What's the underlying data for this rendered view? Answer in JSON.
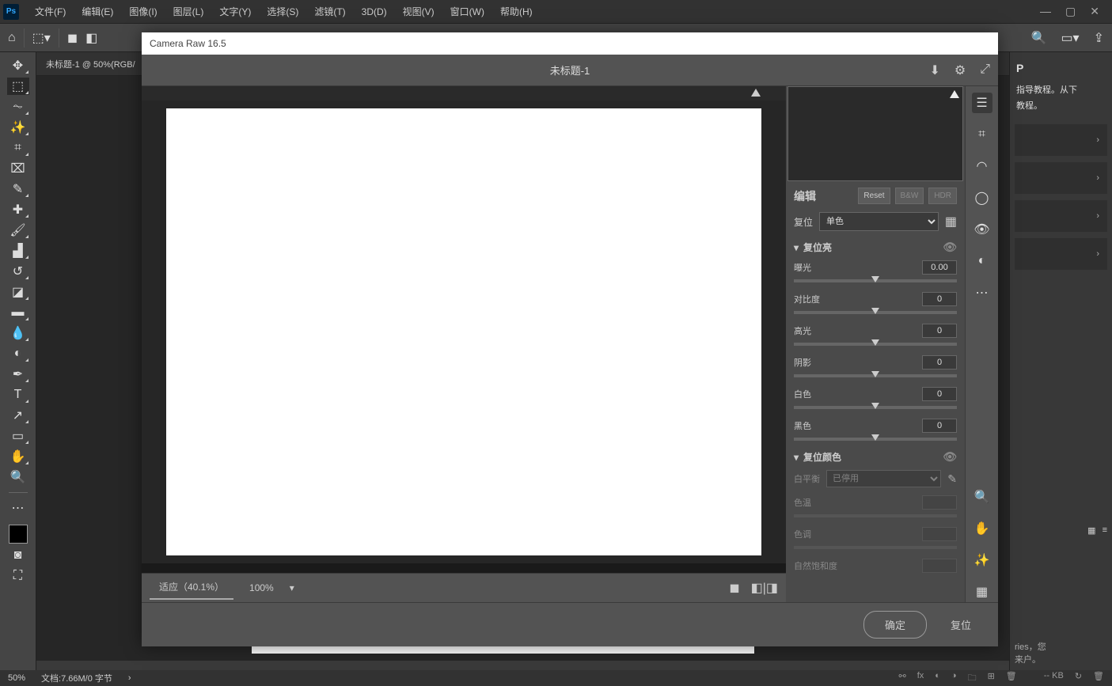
{
  "app": {
    "logo": "Ps"
  },
  "menu": {
    "file": "文件(F)",
    "edit": "编辑(E)",
    "image": "图像(I)",
    "layer": "图层(L)",
    "type": "文字(Y)",
    "select": "选择(S)",
    "filter": "滤镜(T)",
    "threeD": "3D(D)",
    "view": "视图(V)",
    "window": "窗口(W)",
    "help": "帮助(H)"
  },
  "doc": {
    "tab": "未标题-1 @ 50%(RGB/",
    "zoom": "50%",
    "info": "文档:7.66M/0 字节"
  },
  "rightTips": {
    "line1": "指导教程。从下",
    "line2": "教程。"
  },
  "statusRight": {
    "kb": "-- KB"
  },
  "cameraRaw": {
    "title": "Camera Raw 16.5",
    "docName": "未标题-1",
    "zoom": {
      "fit": "适应（40.1%）",
      "hundred": "100%"
    },
    "edit": {
      "title": "编辑",
      "reset": "Reset",
      "bw": "B&W",
      "hdr": "HDR",
      "profileLabel": "复位",
      "profileValue": "单色"
    },
    "sectionLight": {
      "title": "复位亮",
      "exposure": {
        "label": "曝光",
        "value": "0.00"
      },
      "contrast": {
        "label": "对比度",
        "value": "0"
      },
      "highlights": {
        "label": "高光",
        "value": "0"
      },
      "shadows": {
        "label": "阴影",
        "value": "0"
      },
      "whites": {
        "label": "白色",
        "value": "0"
      },
      "blacks": {
        "label": "黑色",
        "value": "0"
      }
    },
    "sectionColor": {
      "title": "复位颜色",
      "wbLabel": "白平衡",
      "wbValue": "已停用",
      "temp": "色温",
      "tint": "色调",
      "vibrance": "自然饱和度"
    },
    "footer": {
      "ok": "确定",
      "reset": "复位"
    }
  }
}
